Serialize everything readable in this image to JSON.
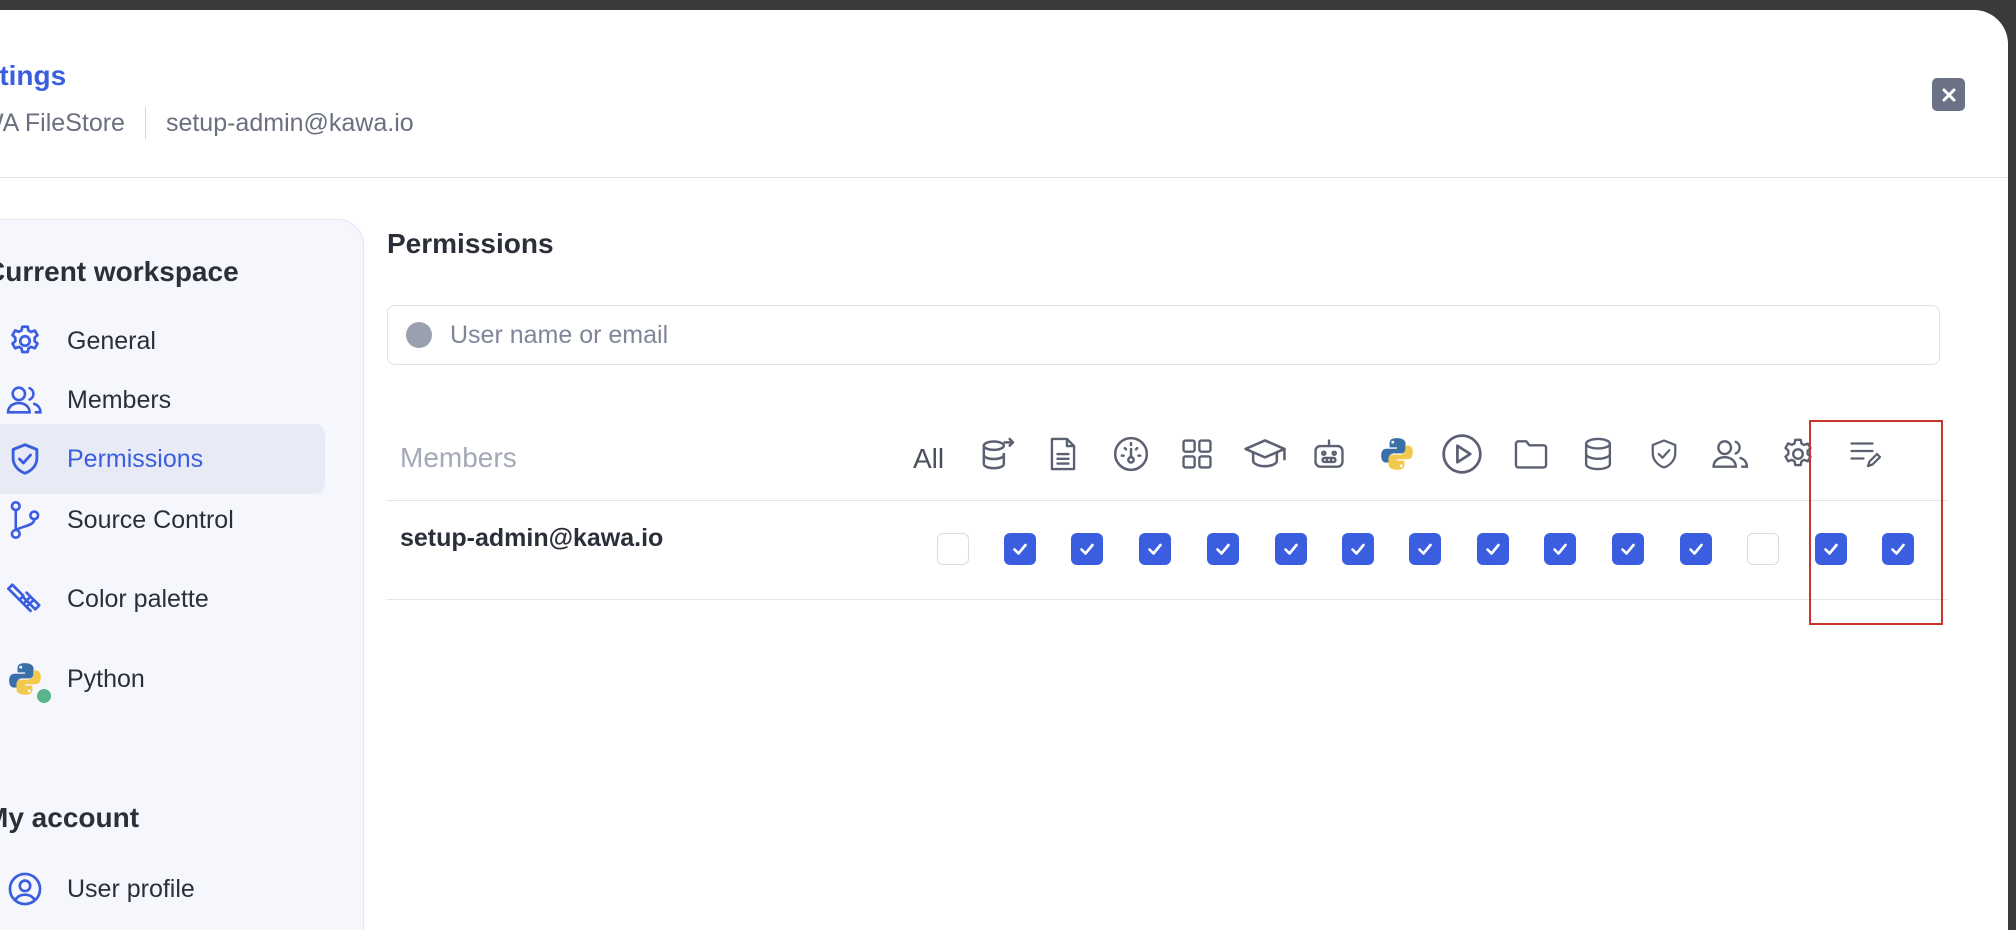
{
  "header": {
    "title": "ttings",
    "workspace": "WA FileStore",
    "user": "setup-admin@kawa.io"
  },
  "sidebar": {
    "current_workspace_title": "Current workspace",
    "items": [
      {
        "label": "General",
        "icon": "gear-icon"
      },
      {
        "label": "Members",
        "icon": "users-icon"
      },
      {
        "label": "Permissions",
        "icon": "shield-check-icon",
        "active": true
      },
      {
        "label": "Source Control",
        "icon": "git-branch-icon"
      },
      {
        "label": "Color palette",
        "icon": "paint-brush-icon"
      },
      {
        "label": "Python",
        "icon": "python-icon",
        "status_dot_color": "#5ab58a"
      }
    ],
    "my_account_title": "My account",
    "account_items": [
      {
        "label": "User profile",
        "icon": "user-circle-icon"
      }
    ]
  },
  "permissions": {
    "title": "Permissions",
    "search_placeholder": "User name or email",
    "columns": {
      "members": "Members",
      "all": "All",
      "icons": [
        "database-export-icon",
        "document-icon",
        "dashboard-gauge-icon",
        "apps-grid-icon",
        "graduation-cap-icon",
        "robot-icon",
        "python-icon",
        "play-circle-icon",
        "folder-icon",
        "database-icon",
        "shield-check-icon",
        "users-icon",
        "gear-icon",
        "list-edit-icon"
      ]
    },
    "rows": [
      {
        "email": "setup-admin@kawa.io",
        "all": false,
        "checks": [
          true,
          true,
          true,
          true,
          true,
          true,
          true,
          true,
          true,
          true,
          true,
          false,
          true,
          true
        ]
      }
    ]
  },
  "colors": {
    "accent": "#3b5ee0",
    "annotation": "#c8352a"
  }
}
